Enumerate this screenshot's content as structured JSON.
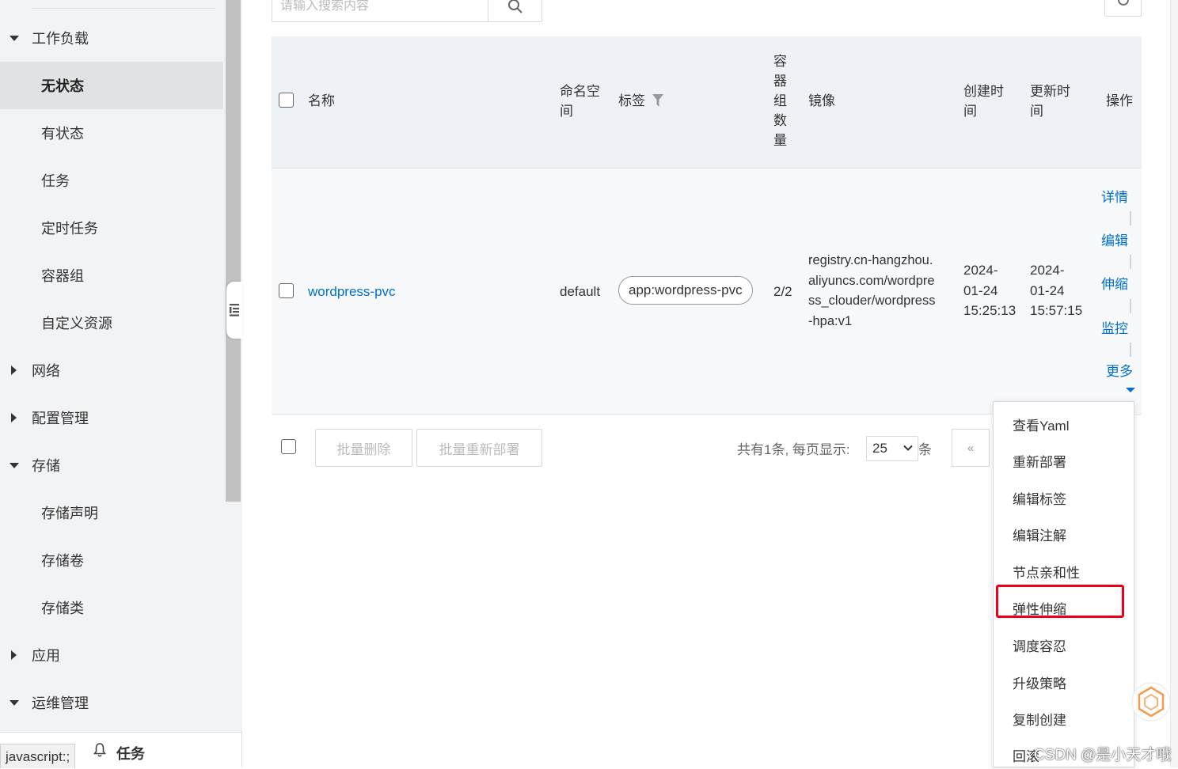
{
  "sidebar": {
    "groups": [
      {
        "label": "工作负载",
        "expanded": true
      },
      {
        "label": "网络",
        "expanded": false
      },
      {
        "label": "配置管理",
        "expanded": false
      },
      {
        "label": "存储",
        "expanded": true
      },
      {
        "label": "应用",
        "expanded": false
      },
      {
        "label": "运维管理",
        "expanded": true
      }
    ],
    "workload_items": [
      "无状态",
      "有状态",
      "任务",
      "定时任务",
      "容器组",
      "自定义资源"
    ],
    "storage_items": [
      "存储声明",
      "存储卷",
      "存储类"
    ],
    "active": "无状态"
  },
  "status_bar": {
    "url": "javascript:;",
    "task_label": "任务"
  },
  "search": {
    "placeholder": "请输入搜索内容"
  },
  "table": {
    "headers": {
      "name": "名称",
      "namespace": "命名空\n间",
      "labels": "标签",
      "pods": "容\n器\n组\n数\n量",
      "image": "镜像",
      "created": "创建时\n间",
      "updated": "更新时\n间",
      "actions": "操作"
    },
    "rows": [
      {
        "name": "wordpress-pvc",
        "namespace": "default",
        "label": "app:wordpress-pvc",
        "pods": "2/2",
        "image": "registry.cn-hangzhou.\naliyuncs.com/wordpre\nss_clouder/wordpress\n-hpa:v1",
        "created": "2024-\n01-24\n15:25:13",
        "updated": "2024-\n01-24\n15:57:15",
        "actions": [
          "详情",
          "编辑",
          "伸缩",
          "监控",
          "更多"
        ]
      }
    ]
  },
  "footer": {
    "batch_delete": "批量删除",
    "batch_redeploy": "批量重新部署",
    "total_text": "共有1条, 每页显示:",
    "page_size": "25",
    "unit": "条",
    "prev": "«"
  },
  "more_menu": {
    "items": [
      "查看Yaml",
      "重新部署",
      "编辑标签",
      "编辑注解",
      "节点亲和性",
      "弹性伸缩",
      "调度容忍",
      "升级策略",
      "复制创建",
      "回滚"
    ],
    "highlighted": "弹性伸缩",
    "highlight_color": "#e8001c"
  },
  "watermark": "CSDN @是小天才哦",
  "colors": {
    "link": "#0070cc",
    "header_bg": "#eef1f6",
    "sidebar_bg": "#f2f3f5"
  }
}
